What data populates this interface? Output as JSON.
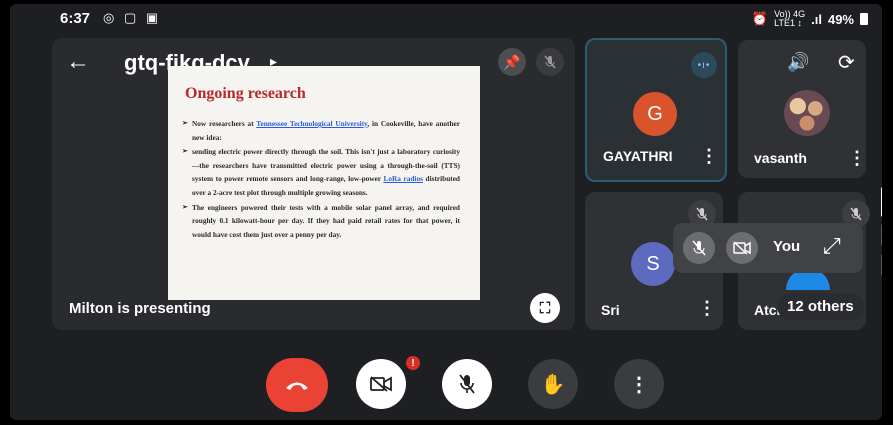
{
  "status_bar": {
    "time": "6:37",
    "left_icons": "◎ ▢ ▣",
    "network_small": "Vo)) 4G\nLTE1 ↕",
    "signal": ".ıl",
    "battery_text": "49%",
    "alarm_icon": "alarm-icon"
  },
  "main": {
    "meeting_code": "gtq-fjkq-dcv",
    "presenting_label": "Milton is presenting",
    "slide": {
      "title": "Ongoing research",
      "bullets": [
        {
          "pre": "Now researchers at ",
          "link": "Tennessee Technological University",
          "post": ", in Cookeville, have another new idea:"
        },
        {
          "pre": "sending electric power directly through the soil. This isn't just a laboratory curiosity—the researchers have transmitted electric power using a through-the-soil (TTS) system to power remote sensors and long-range, low-power ",
          "link": "LoRa radios",
          "post": " distributed over a 2-acre test plot through multiple growing seasons."
        },
        {
          "pre": "The engineers powered their tests with a mobile solar panel array, and required roughly 0.1 kilowatt-hour per day. If they had paid retail rates for that power, it would have cost them just over a penny per day.",
          "link": "",
          "post": ""
        }
      ]
    }
  },
  "participants": [
    {
      "name": "GAYATHRI",
      "initial": "G",
      "color": "#d9532c"
    },
    {
      "name": "vasanth",
      "initial": "",
      "color": ""
    },
    {
      "name": "Sri",
      "initial": "S",
      "color": "#5c6bc0"
    },
    {
      "name": "Atch",
      "initial": "",
      "color": "#1e88e5"
    }
  ],
  "self_view": {
    "label": "You"
  },
  "others_label": "12 others",
  "controls": {
    "badge": "!"
  },
  "colors": {
    "end_call": "#ea4335",
    "active_tile_border": "#2b5d73"
  }
}
